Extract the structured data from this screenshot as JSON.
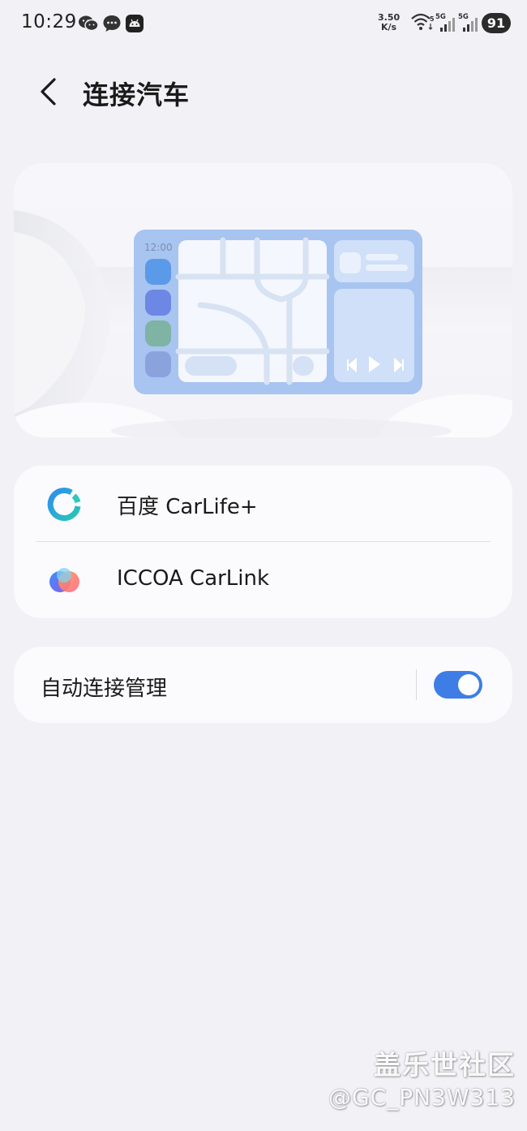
{
  "status_bar": {
    "time": "10:29",
    "net_speed_value": "3.50",
    "net_speed_unit": "K/s",
    "wifi_badge": "5",
    "sim1_label": "5G",
    "sim2_label": "5G",
    "battery": "91",
    "notification_icons": [
      "wechat-icon",
      "message-icon",
      "android-icon"
    ]
  },
  "header": {
    "title": "连接汽车",
    "back_icon": "chevron-left-icon"
  },
  "illustration": {
    "screen_time": "12:00"
  },
  "apps": [
    {
      "label": "百度 CarLife+",
      "icon": "carlife-icon"
    },
    {
      "label": "ICCOA CarLink",
      "icon": "carlink-icon"
    }
  ],
  "auto_connect": {
    "label": "自动连接管理",
    "enabled": true
  },
  "watermark": {
    "line1": "盖乐世社区",
    "line2": "@GC_PN3W313"
  },
  "colors": {
    "background": "#f1f1f6",
    "card": "#fbfbfd",
    "accent": "#3f7de6"
  }
}
